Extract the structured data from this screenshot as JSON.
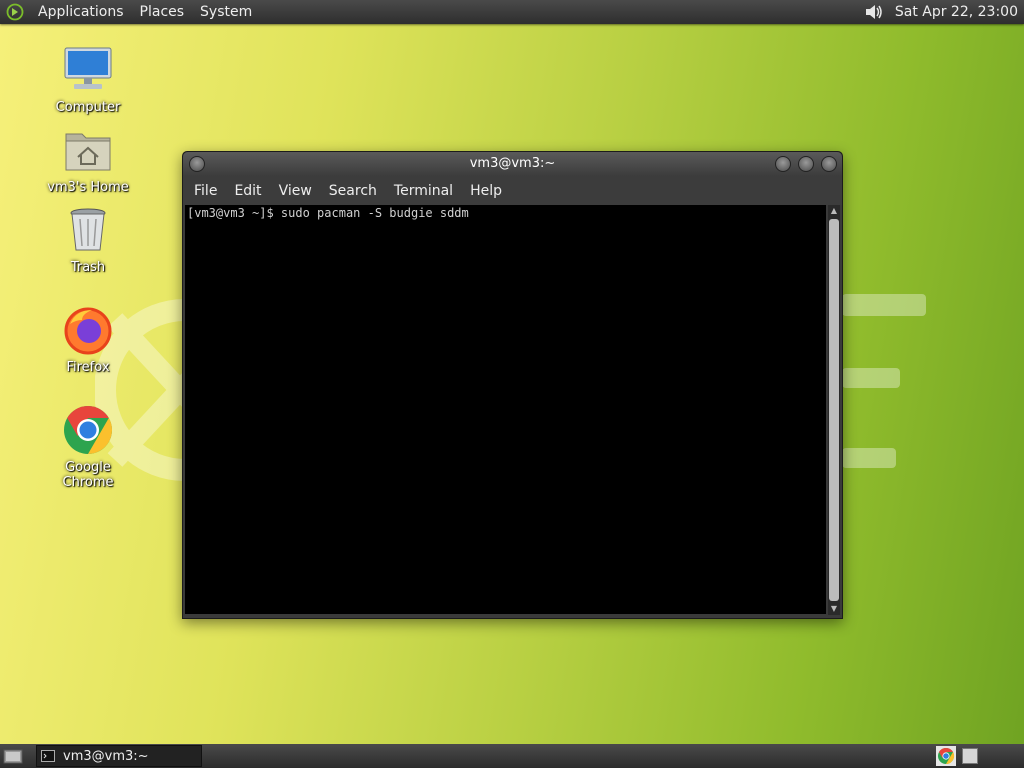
{
  "top_panel": {
    "menus": [
      "Applications",
      "Places",
      "System"
    ],
    "clock": "Sat Apr 22, 23:00"
  },
  "desktop_icons": [
    {
      "label": "Computer"
    },
    {
      "label": "vm3's Home"
    },
    {
      "label": "Trash"
    },
    {
      "label": "Firefox"
    },
    {
      "label": "Google Chrome"
    }
  ],
  "terminal": {
    "title": "vm3@vm3:~",
    "menu": [
      "File",
      "Edit",
      "View",
      "Search",
      "Terminal",
      "Help"
    ],
    "lines": [
      "[vm3@vm3 ~]$ sudo pacman -S budgie sddm"
    ]
  },
  "bottom_panel": {
    "task_label": "vm3@vm3:~"
  },
  "colors": {
    "panel": "#3a3a3a",
    "terminal_bg": "#000000",
    "desktop_green": "#8fbb2c"
  }
}
